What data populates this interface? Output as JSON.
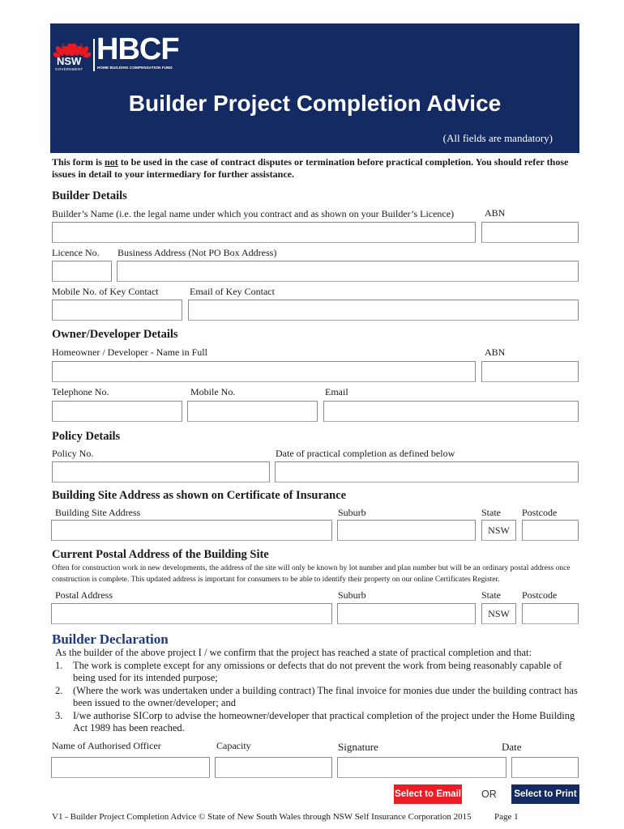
{
  "header": {
    "logo": {
      "government": "NSW",
      "government_sub": "GOVERNMENT",
      "brand": "HBCF",
      "brand_sub": "HOME BUILDING COMPENSATION FUND"
    },
    "title": "Builder Project Completion Advice",
    "mandatory_note": "(All fields are mandatory)"
  },
  "notice": {
    "part1": "This form is ",
    "emphasis": "not",
    "part2": " to be used in the case of contract disputes or termination before practical completion. You should refer those issues in detail to your intermediary for further assistance."
  },
  "builder_details": {
    "heading": "Builder Details",
    "builders_name_label": "Builder’s Name (i.e. the legal name under which you contract and as shown on your Builder’s Licence)",
    "abn_label": "ABN",
    "licence_label": "Licence No.",
    "business_address_label": "Business Address (Not PO Box Address)",
    "mobile_label": "Mobile No. of Key Contact",
    "email_label": "Email of Key Contact",
    "values": {
      "builders_name": "",
      "abn": "",
      "licence": "",
      "business_address": "",
      "mobile": "",
      "email": ""
    }
  },
  "owner_details": {
    "heading": "Owner/Developer Details",
    "name_label": "Homeowner / Developer  - Name in Full",
    "abn_label": "ABN",
    "telephone_label": "Telephone No.",
    "mobile_label": "Mobile No.",
    "email_label": "Email",
    "values": {
      "name": "",
      "abn": "",
      "telephone": "",
      "mobile": "",
      "email": ""
    }
  },
  "policy_details": {
    "heading": "Policy Details",
    "policy_label": "Policy No.",
    "date_label": "Date of practical completion as defined below",
    "values": {
      "policy": "",
      "date": ""
    }
  },
  "site_address": {
    "heading": "Building Site Address as shown on Certificate of Insurance",
    "address_label": "Building Site Address",
    "suburb_label": "Suburb",
    "state_label": "State",
    "postcode_label": "Postcode",
    "state_value": "NSW",
    "values": {
      "address": "",
      "suburb": "",
      "postcode": ""
    }
  },
  "postal_address": {
    "heading": "Current Postal Address of the Building Site",
    "description": "Often for construction work in new developments, the address of the site will only be known by lot number and plan number but will be an ordinary postal address once construction is complete. This updated address is important for consumers to be able to identify their property on our online Certificates Register.",
    "address_label": "Postal Address",
    "suburb_label": "Suburb",
    "state_label": "State",
    "postcode_label": "Postcode",
    "state_value": "NSW",
    "values": {
      "address": "",
      "suburb": "",
      "postcode": ""
    }
  },
  "declaration": {
    "heading": "Builder Declaration",
    "intro": "As the builder of the above project I / we confirm that the project has reached a state of practical completion and that:",
    "items": [
      {
        "num": "1.",
        "text": "The work is complete except for any omissions or defects that do not prevent the work from being reasonably capable of being used for its intended purpose;"
      },
      {
        "num": "2.",
        "text": "(Where the work was undertaken under a building contract) The final invoice for monies due under the building contract has been issued to the owner/developer; and"
      },
      {
        "num": "3.",
        "text": "I/we authorise SICorp to advise the homeowner/developer that practical completion of the project under the Home Building Act 1989 has been reached."
      }
    ],
    "officer_label": "Name of Authorised Officer",
    "capacity_label": "Capacity",
    "signature_label": "Signature",
    "date_label": "Date",
    "values": {
      "officer": "",
      "capacity": "",
      "signature": "",
      "date": ""
    }
  },
  "actions": {
    "email_label": "Select to Email",
    "or_label": "OR",
    "print_label": "Select to Print",
    "email_color": "#ee1c25",
    "print_color": "#142a63"
  },
  "footer": {
    "text": "V1 - Builder Project Completion Advice  ©  State of New South Wales through NSW Self Insurance Corporation 2015",
    "page": "Page  1"
  }
}
